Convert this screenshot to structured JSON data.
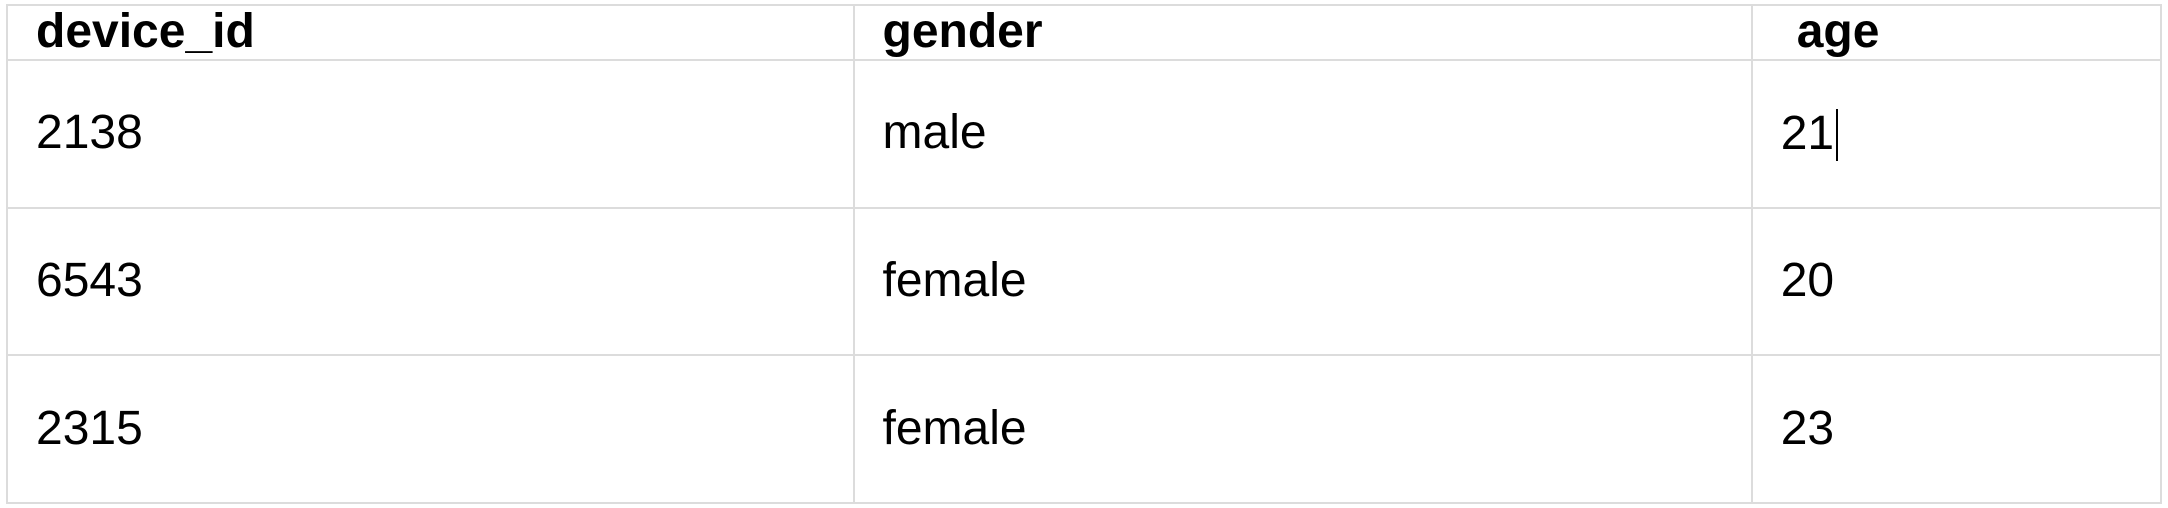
{
  "table": {
    "headers": [
      "device_id",
      "gender",
      " age"
    ],
    "rows": [
      {
        "device_id": "2138",
        "gender": "male",
        "age": "21"
      },
      {
        "device_id": "6543",
        "gender": "female",
        "age": "20"
      },
      {
        "device_id": "2315",
        "gender": "female",
        "age": "23"
      }
    ],
    "cursor": {
      "row": 0,
      "col": 2
    }
  }
}
